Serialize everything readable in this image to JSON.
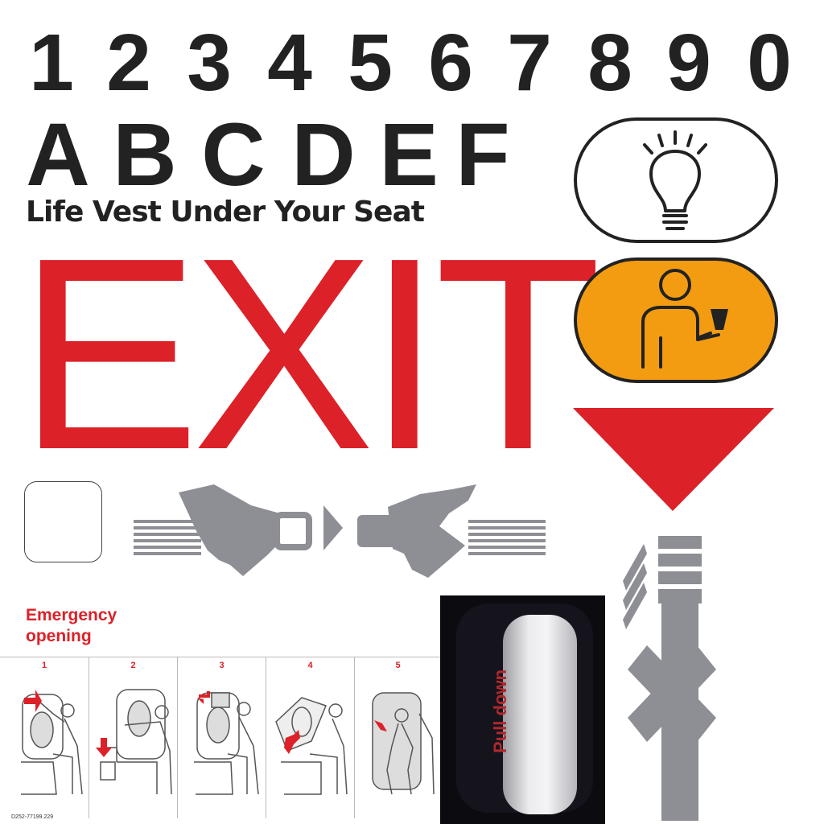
{
  "digits": [
    "1",
    "2",
    "3",
    "4",
    "5",
    "6",
    "7",
    "8",
    "9",
    "0"
  ],
  "letters": [
    "A",
    "B",
    "C",
    "D",
    "E",
    "F"
  ],
  "life_vest_text": "Life Vest Under Your Seat",
  "exit_text": "EXIT",
  "emergency": {
    "title_line1": "Emergency",
    "title_line2": "opening",
    "steps": [
      "1",
      "2",
      "3",
      "4",
      "5"
    ],
    "document_code": "D252-77199.229"
  },
  "handle": {
    "label": "Pull down"
  },
  "colors": {
    "exit_red": "#dc2128",
    "attendant_orange": "#f39c12",
    "icon_gray": "#8e8e95",
    "text_dark": "#222222"
  },
  "icons": [
    "reading-light-icon",
    "attendant-call-icon",
    "down-arrow-icon",
    "seatbelt-buckle-icon",
    "seatbelt-strap-icon"
  ]
}
